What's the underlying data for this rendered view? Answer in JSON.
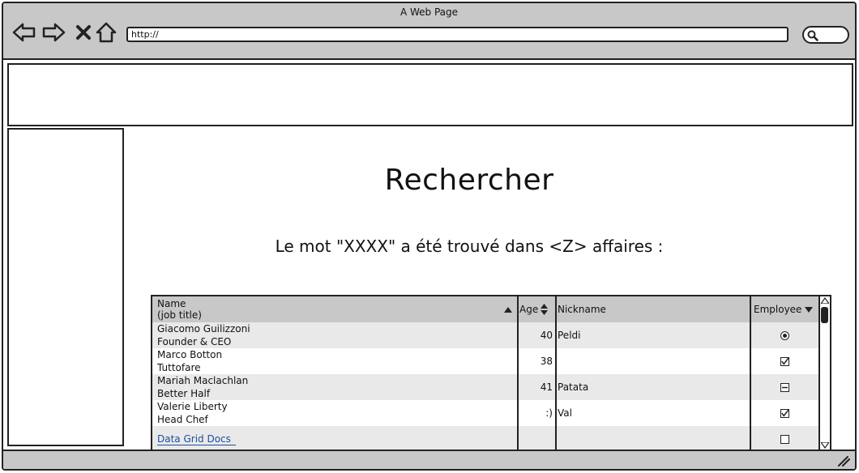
{
  "window": {
    "title": "A Web Page",
    "url": "http://"
  },
  "main": {
    "heading": "Rechercher",
    "result_text": "Le mot \"XXXX\" a été trouvé dans <Z> affaires :"
  },
  "grid": {
    "columns": {
      "name_line1": "Name",
      "name_line2": "(job title)",
      "age": "Age",
      "nickname": "Nickname",
      "employee": "Employee"
    },
    "rows": [
      {
        "name": "Giacomo Guilizzoni",
        "title": "Founder & CEO",
        "age": "40",
        "nickname": "Peldi",
        "employee": "radio-selected"
      },
      {
        "name": "Marco Botton",
        "title": "Tuttofare",
        "age": "38",
        "nickname": "",
        "employee": "checked"
      },
      {
        "name": "Mariah Maclachlan",
        "title": "Better Half",
        "age": "41",
        "nickname": "Patata",
        "employee": "indeterminate"
      },
      {
        "name": "Valerie Liberty",
        "title": "Head Chef",
        "age": ":)",
        "nickname": "Val",
        "employee": "checked"
      }
    ],
    "link_row": {
      "link_text": "Data Grid Docs",
      "employee": "unchecked"
    }
  }
}
